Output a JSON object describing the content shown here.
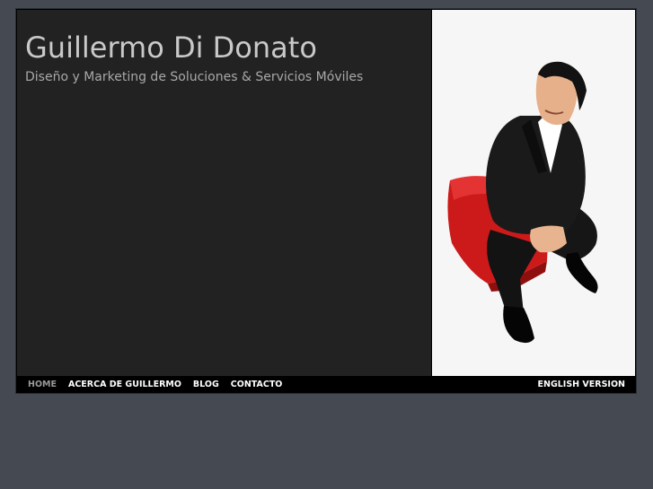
{
  "header": {
    "title": "Guillermo Di Donato",
    "tagline": "Diseño y Marketing de Soluciones & Servicios Móviles"
  },
  "nav": {
    "items": [
      {
        "label": "HOME",
        "active": true
      },
      {
        "label": "ACERCA DE GUILLERMO",
        "active": false
      },
      {
        "label": "BLOG",
        "active": false
      },
      {
        "label": "CONTACTO",
        "active": false
      }
    ],
    "language_link": "ENGLISH VERSION"
  },
  "colors": {
    "page_background": "#454a52",
    "header_background": "#222222",
    "navbar_background": "#000000",
    "nav_active": "#9a9a9a",
    "photo_background": "#f7f6f6"
  }
}
